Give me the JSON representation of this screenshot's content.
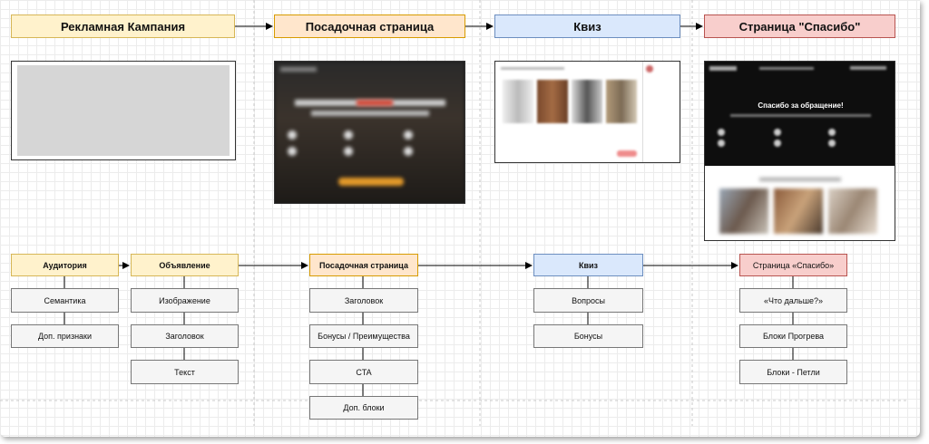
{
  "top_row": {
    "ad_campaign": "Рекламная Кампания",
    "landing": "Посадочная страница",
    "quiz": "Квиз",
    "thanks": "Страница \"Спасибо\""
  },
  "thanks_preview": {
    "title": "Спасибо за обращение!"
  },
  "bottom_row": {
    "audience": {
      "title": "Аудитория",
      "items": [
        "Семантика",
        "Доп. признаки"
      ]
    },
    "ad": {
      "title": "Объявление",
      "items": [
        "Изображение",
        "Заголовок",
        "Текст"
      ]
    },
    "landing": {
      "title": "Посадочная страница",
      "items": [
        "Заголовок",
        "Бонусы / Преимущества",
        "CTA",
        "Доп. блоки"
      ]
    },
    "quiz": {
      "title": "Квиз",
      "items": [
        "Вопросы",
        "Бонусы"
      ]
    },
    "thanks": {
      "title": "Страница «Спасибо»",
      "items": [
        "«Что дальше?»",
        "Блоки Прогрева",
        "Блоки - Петли"
      ]
    }
  },
  "colors": {
    "yellow": "#fff2cc",
    "orange": "#ffe6cc",
    "blue": "#dae8fc",
    "red": "#f8cecc",
    "gray": "#f5f5f5"
  }
}
